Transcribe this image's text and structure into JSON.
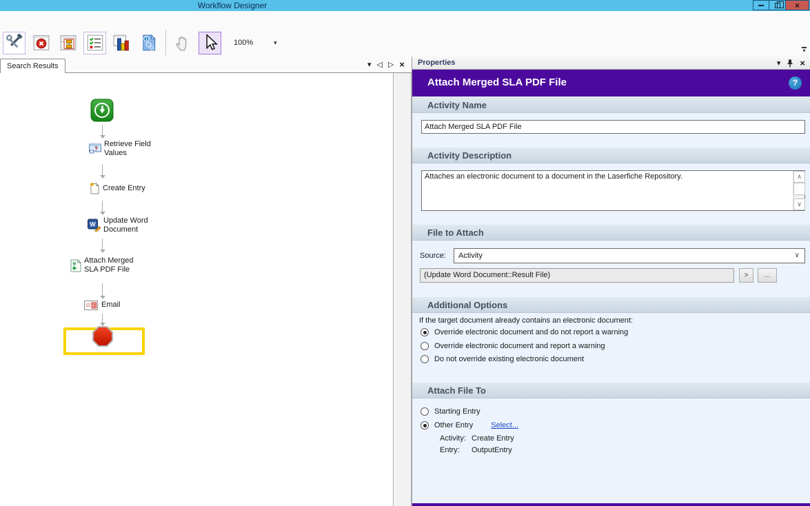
{
  "window": {
    "title": "Workflow Designer"
  },
  "icons": {
    "dropdown_glyph": "▾",
    "prev_glyph": "◁",
    "next_glyph": "▷",
    "close_glyph": "×",
    "up_glyph": "∧",
    "down_glyph": "∨",
    "help_glyph": "?"
  },
  "colors": {
    "titlebar_blue": "#55c1eb",
    "accent_purple": "#4b0a9d",
    "highlight_yellow": "#f7d400",
    "help_blue": "#1b74b8",
    "close_red": "#c75b52",
    "link_blue": "#1b49c8",
    "panel_body_blue": "#ecf3fc",
    "start_green": "#1ea01e",
    "stop_red": "#e02b10"
  },
  "toolbar": {
    "zoom_value": "100%",
    "buttons": [
      {
        "icon": "tools-icon"
      },
      {
        "icon": "error-list-icon"
      },
      {
        "icon": "workflow-diagram-icon"
      },
      {
        "icon": "task-list-icon"
      },
      {
        "icon": "statistics-icon"
      },
      {
        "icon": "workflow-info-icon"
      },
      {
        "icon": "pan-hand-icon"
      },
      {
        "icon": "pointer-icon"
      }
    ]
  },
  "left_panel": {
    "tab_label": "Search Results"
  },
  "workflow": {
    "nodes": [
      {
        "type": "start",
        "icon": "start-icon",
        "label": ""
      },
      {
        "type": "activity",
        "icon": "field-values-icon",
        "label": "Retrieve Field Values"
      },
      {
        "type": "activity",
        "icon": "new-document-icon",
        "label": "Create Entry"
      },
      {
        "type": "activity",
        "icon": "word-document-icon",
        "label": "Update Word Document"
      },
      {
        "type": "activity",
        "icon": "electronic-document-icon",
        "label": "Attach Merged SLA PDF File",
        "highlighted": true
      },
      {
        "type": "activity",
        "icon": "email-icon",
        "label": "Email"
      },
      {
        "type": "end",
        "icon": "stop-icon",
        "label": ""
      }
    ]
  },
  "properties": {
    "panel_title": "Properties",
    "activity_title": "Attach Merged SLA PDF File",
    "activity_name": {
      "header": "Activity Name",
      "value": "Attach Merged SLA PDF File"
    },
    "activity_description": {
      "header": "Activity Description",
      "value": "Attaches an electronic document to a document in the Laserfiche Repository."
    },
    "file_to_attach": {
      "header": "File to Attach",
      "source_label": "Source:",
      "source_value": "Activity",
      "token_value": "(Update Word Document::Result File)",
      "token_button": ">",
      "browse_button": "..."
    },
    "additional_options": {
      "header": "Additional Options",
      "intro": "If the target document already contains an electronic document:",
      "options": [
        {
          "label": "Override electronic document and do not report a warning",
          "selected": true
        },
        {
          "label": "Override electronic document and report a warning",
          "selected": false
        },
        {
          "label": "Do not override existing electronic document",
          "selected": false
        }
      ]
    },
    "attach_file_to": {
      "header": "Attach File To",
      "options": [
        {
          "label": "Starting Entry",
          "selected": false
        },
        {
          "label": "Other Entry",
          "selected": true
        }
      ],
      "select_link": "Select...",
      "details": [
        {
          "label": "Activity:",
          "value": "Create Entry"
        },
        {
          "label": "Entry:",
          "value": "OutputEntry"
        }
      ]
    }
  }
}
